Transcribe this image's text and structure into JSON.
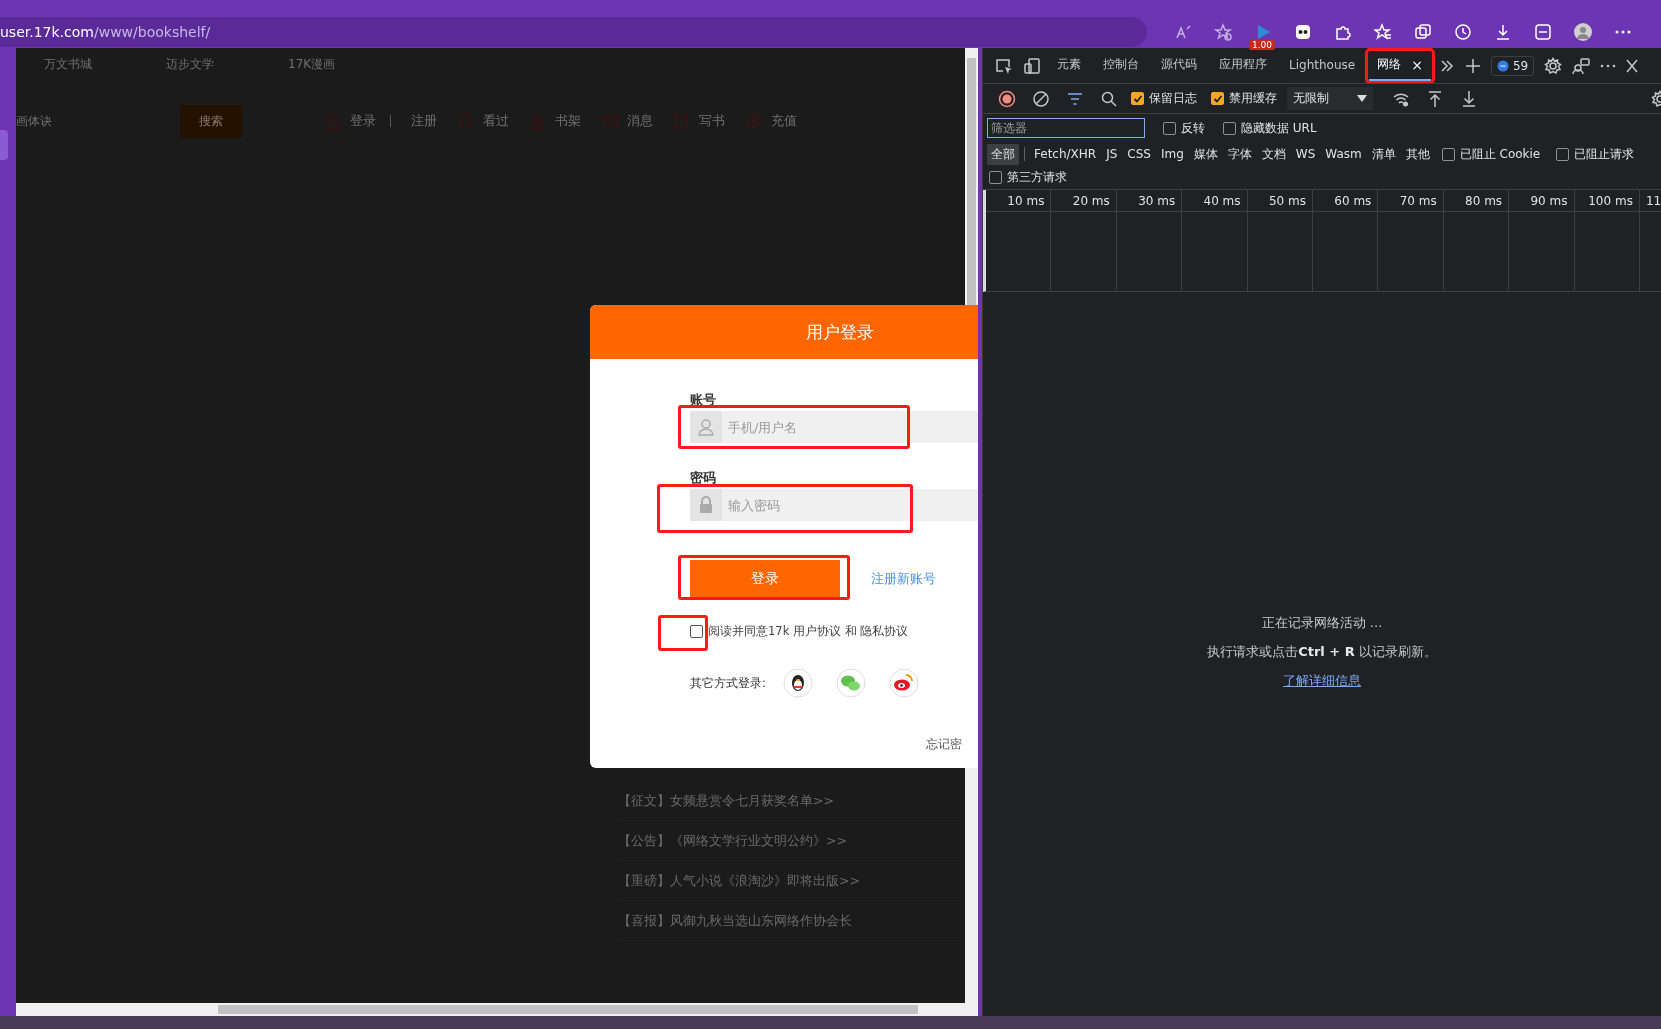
{
  "browser": {
    "address_host": "user.17k.com",
    "address_path": "/www/bookshelf/",
    "toolbar_icons": [
      {
        "kind": "read"
      },
      {
        "kind": "star-add"
      },
      {
        "kind": "extension",
        "badge": "1.00"
      },
      {
        "kind": "ghost"
      },
      {
        "kind": "puzzle"
      },
      {
        "kind": "favorites"
      },
      {
        "kind": "collections"
      },
      {
        "kind": "history"
      },
      {
        "kind": "download"
      },
      {
        "kind": "math"
      },
      {
        "kind": "avatar"
      },
      {
        "kind": "more"
      }
    ]
  },
  "page": {
    "nav": [
      "万文书城",
      "迈步文学",
      "17K漫画"
    ],
    "search_text": "画体诀",
    "search_button": "搜索",
    "user_links": [
      {
        "kind": "user",
        "label": "登录",
        "divider_after": true
      },
      {
        "kind": "plain",
        "label": "注册",
        "divider_after": false
      },
      {
        "kind": "refresh",
        "label": "看过",
        "divider_after": false
      },
      {
        "kind": "shelf",
        "label": "书架",
        "divider_after": false
      },
      {
        "kind": "mail",
        "label": "消息",
        "divider_after": false
      },
      {
        "kind": "pen",
        "label": "写书",
        "divider_after": false
      },
      {
        "kind": "coin",
        "label": "充值",
        "divider_after": false
      }
    ],
    "news": [
      "【征文】女频悬赏令七月获奖名单>>",
      "【公告】《网络文学行业文明公约》>>",
      "【重磅】人气小说《浪淘沙》即将出版>>",
      "【喜报】风御九秋当选山东网络作协会长"
    ]
  },
  "login_dialog": {
    "title": "用户登录",
    "fields": [
      {
        "label": "账号",
        "kind": "user",
        "placeholder": "手机/用户名",
        "annotated": true
      },
      {
        "label": "密码",
        "kind": "lock",
        "placeholder": "输入密码",
        "annotated": true
      }
    ],
    "login_button": {
      "label": "登录",
      "annotated": true
    },
    "register_link": "注册新账号",
    "agree": {
      "checked": false,
      "annotated": true,
      "text": "阅读并同意17k 用户协议 和 隐私协议"
    },
    "other_login_label": "其它方式登录:",
    "other_login": [
      {
        "kind": "qq"
      },
      {
        "kind": "wechat"
      },
      {
        "kind": "weibo"
      }
    ],
    "forgot": "忘记密"
  },
  "devtools": {
    "tabs": [
      {
        "label": "元素",
        "selected": false,
        "closable": false,
        "annotated": false
      },
      {
        "label": "控制台",
        "selected": false,
        "closable": false,
        "annotated": false
      },
      {
        "label": "源代码",
        "selected": false,
        "closable": false,
        "annotated": false
      },
      {
        "label": "应用程序",
        "selected": false,
        "closable": false,
        "annotated": false
      },
      {
        "label": "Lighthouse",
        "selected": false,
        "closable": false,
        "annotated": false
      },
      {
        "label": "网络",
        "selected": true,
        "closable": true,
        "annotated": true
      }
    ],
    "close_glyph": "×",
    "issues_count": "59",
    "toolbar": {
      "recording": true,
      "filter_on": true,
      "checks": [
        {
          "label": "保留日志",
          "checked": true
        },
        {
          "label": "禁用缓存",
          "checked": true
        }
      ],
      "throttle": "无限制"
    },
    "filter": {
      "placeholder": "筛选器",
      "checks": [
        {
          "label": "反转",
          "checked": false
        },
        {
          "label": "隐藏数据 URL",
          "checked": false
        }
      ]
    },
    "types": [
      {
        "label": "全部",
        "selected": true
      },
      {
        "label": "Fetch/XHR",
        "selected": false
      },
      {
        "label": "JS",
        "selected": false
      },
      {
        "label": "CSS",
        "selected": false
      },
      {
        "label": "Img",
        "selected": false
      },
      {
        "label": "媒体",
        "selected": false
      },
      {
        "label": "字体",
        "selected": false
      },
      {
        "label": "文档",
        "selected": false
      },
      {
        "label": "WS",
        "selected": false
      },
      {
        "label": "Wasm",
        "selected": false
      },
      {
        "label": "清单",
        "selected": false
      },
      {
        "label": "其他",
        "selected": false
      }
    ],
    "type_checks": [
      {
        "label": "已阻止 Cookie",
        "checked": false
      },
      {
        "label": "已阻止请求",
        "checked": false
      }
    ],
    "third_party": {
      "label": "第三方请求",
      "checked": false
    },
    "ticks": [
      "10 ms",
      "20 ms",
      "30 ms",
      "40 ms",
      "50 ms",
      "60 ms",
      "70 ms",
      "80 ms",
      "90 ms",
      "100 ms",
      "11"
    ],
    "empty": {
      "line1": "正在记录网络活动 ...",
      "line2": "执行请求或点击**Ctrl + R** 以记录刷新。",
      "link": "了解详细信息"
    }
  }
}
